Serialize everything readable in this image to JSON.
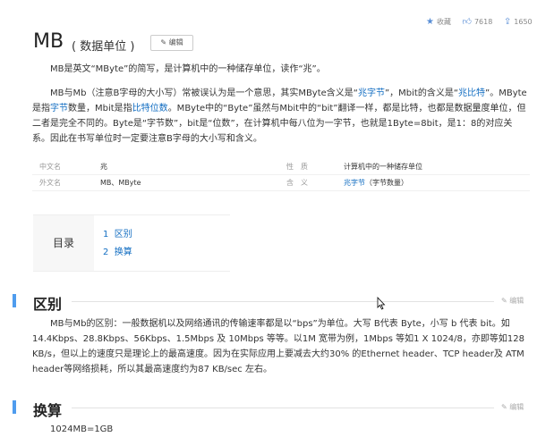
{
  "topbar": {
    "favorite": "收藏",
    "likes": "7618",
    "shares": "1650"
  },
  "title": "MB",
  "subtitle": "( 数据单位 )",
  "edit_label": "编辑",
  "intro": {
    "p1": "MB是英文“MByte”的简写，是计算机中的一种储存单位，读作“兆”。",
    "p2": [
      "MB与Mb（注意B字母的大小写）常被误认为是一个意思，其实MByte含义是“",
      "兆字节",
      "”，Mbit的含义是“",
      "兆比特",
      "”。MByte是指",
      "字节",
      "数量，Mbit是指",
      "比特位数",
      "。MByte中的“Byte”虽然与Mbit中的“bit”翻译一样，都是比特，也都是数据量度单位，但二者是完全不同的。Byte是“字节数”，bit是“位数”，在计算机中每八位为一字节，也就是1Byte=8bit，是1：8的对应关系。因此在书写单位时一定要注意B字母的大小写和含义。"
    ]
  },
  "info": {
    "rows": [
      {
        "k1": "中文名",
        "v1": "兆",
        "k2": "性　质",
        "v2": "计算机中的一种储存单位"
      },
      {
        "k1": "外文名",
        "v1": "MB、MByte",
        "k2": "含　义",
        "v2_link": "兆字节",
        "v2_rest": "（字节数量）"
      }
    ]
  },
  "toc": {
    "title": "目录",
    "items": [
      {
        "num": "1",
        "label": "区别"
      },
      {
        "num": "2",
        "label": "换算"
      }
    ]
  },
  "sections": [
    {
      "title": "区别",
      "edit": "编辑",
      "body": "MB与Mb的区别：一般数据机以及网络通讯的传输速率都是以“bps”为单位。大写 B代表 Byte，小写 b 代表 bit。如14.4Kbps、28.8Kbps、56Kbps、1.5Mbps 及 10Mbps 等等。以1M 宽带为例，1Mbps 等如1 X 1024/8，亦即等如128 KB/s，但以上的速度只是理论上的最高速度。因为在实际应用上要减去大约30% 的Ethernet header、TCP header及 ATM header等网络损耗，所以其最高速度约为87 KB/sec 左右。"
    },
    {
      "title": "换算",
      "edit": "编辑",
      "body": "1024MB=1GB"
    }
  ],
  "colors": {
    "link": "#136ec2",
    "accent": "#4f9cee"
  }
}
